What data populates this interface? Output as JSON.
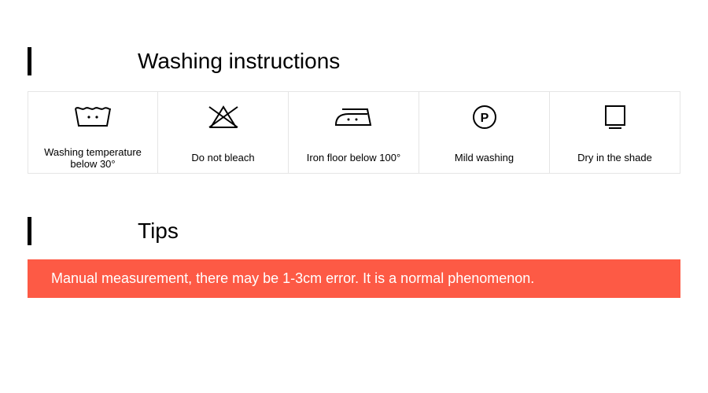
{
  "sections": {
    "washing": {
      "title": "Washing instructions",
      "items": [
        {
          "icon": "wash-30-icon",
          "label": "Washing temperature below 30°"
        },
        {
          "icon": "no-bleach-icon",
          "label": "Do not bleach"
        },
        {
          "icon": "iron-low-icon",
          "label": "Iron floor below 100°"
        },
        {
          "icon": "dryclean-p-icon",
          "label": "Mild washing"
        },
        {
          "icon": "dry-shade-icon",
          "label": "Dry in the shade"
        }
      ]
    },
    "tips": {
      "title": "Tips",
      "banner": "Manual measurement, there may be 1-3cm error. It is a normal phenomenon."
    }
  },
  "colors": {
    "accent_banner": "#fd5a45",
    "border": "#e5e5e5"
  }
}
